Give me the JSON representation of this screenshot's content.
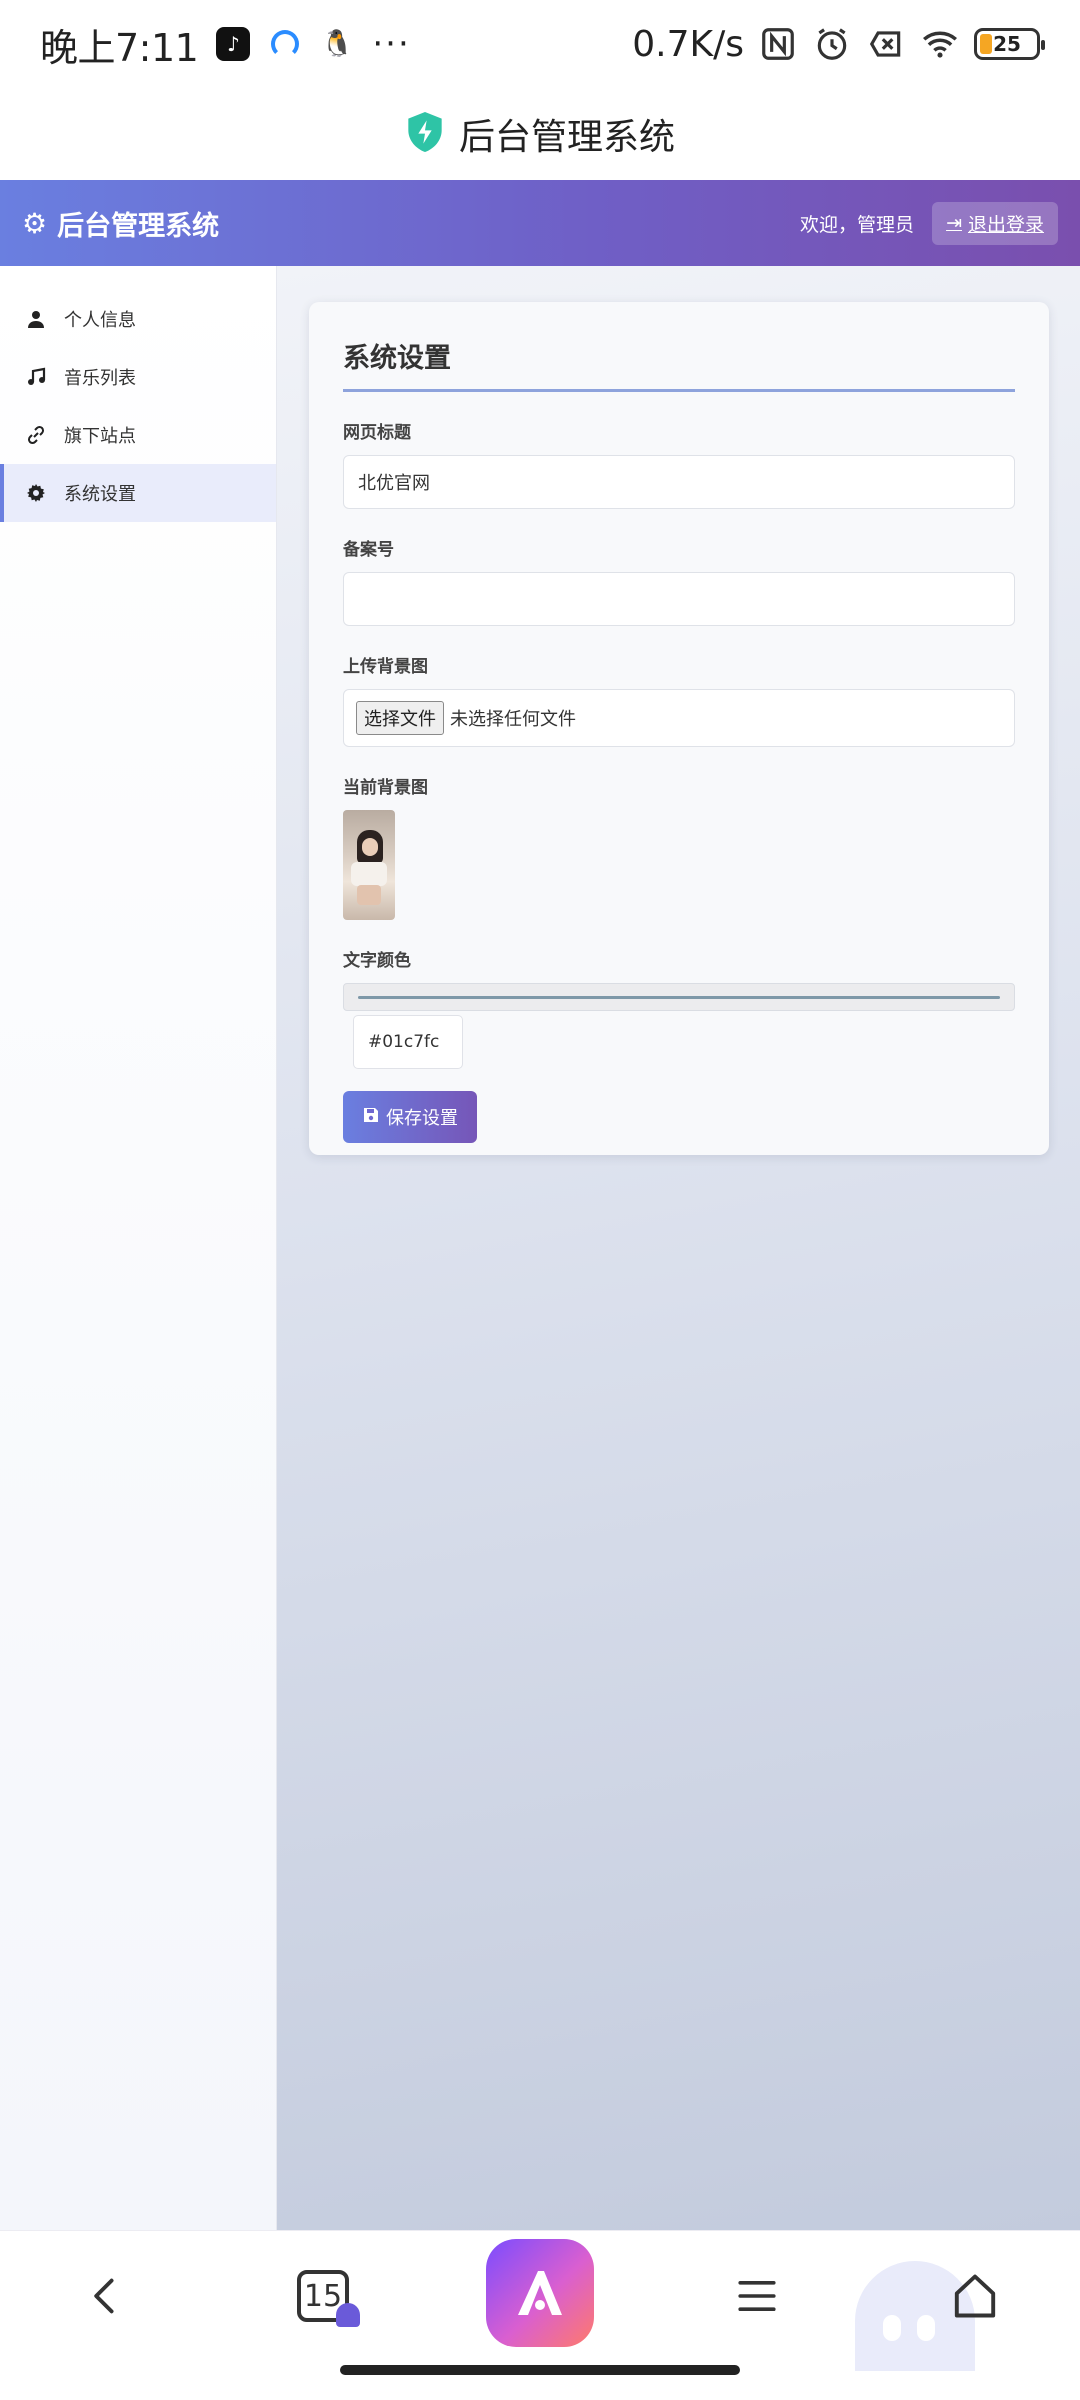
{
  "status_bar": {
    "time": "晚上7:11",
    "speed": "0.7K/s",
    "battery": "25"
  },
  "browser": {
    "page_title": "后台管理系统",
    "tab_count": "15"
  },
  "header": {
    "brand": "后台管理系统",
    "welcome": "欢迎，管理员",
    "logout": "退出登录"
  },
  "sidebar": {
    "items": [
      {
        "label": "个人信息",
        "icon": "user-icon"
      },
      {
        "label": "音乐列表",
        "icon": "music-icon"
      },
      {
        "label": "旗下站点",
        "icon": "link-icon"
      },
      {
        "label": "系统设置",
        "icon": "gear-icon"
      }
    ],
    "active_index": 3
  },
  "settings": {
    "title": "系统设置",
    "page_title_label": "网页标题",
    "page_title_value": "北优官网",
    "icp_label": "备案号",
    "icp_value": "",
    "upload_label": "上传背景图",
    "file_button": "选择文件",
    "file_status": "未选择任何文件",
    "current_bg_label": "当前背景图",
    "text_color_label": "文字颜色",
    "text_color_value": "#01c7fc",
    "save_button": "保存设置"
  },
  "colors": {
    "accent": "#6a7fe0",
    "accent_dark": "#7656b8",
    "shield": "#2ec4a6"
  }
}
